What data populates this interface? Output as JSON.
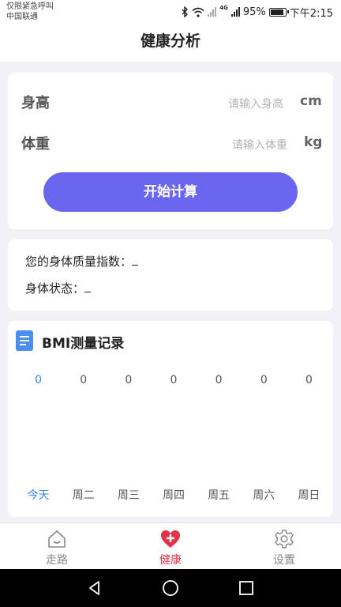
{
  "status_bar": {
    "carrier_line1": "仅限紧急呼叫",
    "carrier_line2": "中国联通",
    "network": "4G",
    "battery": "95%",
    "time": "下午2:15"
  },
  "header": {
    "title": "健康分析"
  },
  "form": {
    "height_label": "身高",
    "height_placeholder": "请输入身高",
    "height_unit": "cm",
    "weight_label": "体重",
    "weight_placeholder": "请输入体重",
    "weight_unit": "kg",
    "calc_button": "开始计算"
  },
  "result": {
    "bmi_label": "您的身体质量指数：",
    "bmi_value": "",
    "state_label": "身体状态：",
    "state_value": ""
  },
  "record": {
    "title": "BMI测量记录",
    "icon": "document-icon",
    "values": [
      "0",
      "0",
      "0",
      "0",
      "0",
      "0",
      "0"
    ],
    "days": [
      "今天",
      "周二",
      "周三",
      "周四",
      "周五",
      "周六",
      "周日"
    ],
    "active_index": 0
  },
  "tabbar": {
    "items": [
      {
        "label": "走路",
        "icon": "home-icon"
      },
      {
        "label": "健康",
        "icon": "health-cross-icon",
        "active": true
      },
      {
        "label": "设置",
        "icon": "gear-icon"
      }
    ]
  },
  "colors": {
    "accent": "#6a66f0",
    "tab_active": "#e03448",
    "chart_active": "#3a86e6",
    "icon_blue": "#4a8ef0"
  }
}
